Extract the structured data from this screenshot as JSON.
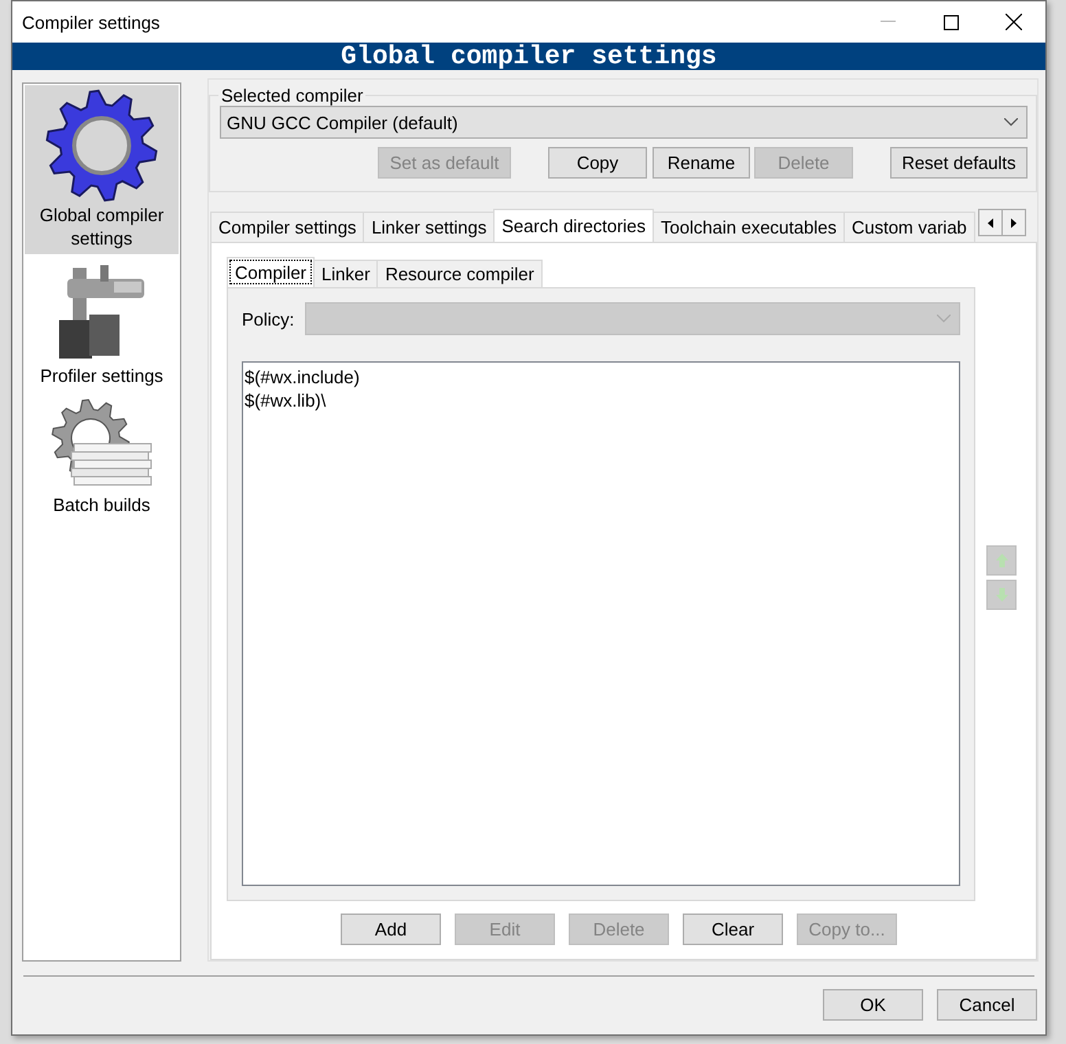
{
  "window": {
    "title": "Compiler settings"
  },
  "banner": "Global compiler settings",
  "sidebar": {
    "items": [
      {
        "label": "Global compiler settings",
        "kind": "gear",
        "selected": true
      },
      {
        "label": "Profiler settings",
        "kind": "caliper",
        "selected": false
      },
      {
        "label": "Batch builds",
        "kind": "batch",
        "selected": false
      }
    ]
  },
  "compiler_group": {
    "label": "Selected compiler",
    "value": "GNU GCC Compiler (default)",
    "buttons": [
      {
        "label": "Set as default",
        "disabled": true
      },
      {
        "label": "Copy",
        "disabled": false
      },
      {
        "label": "Rename",
        "disabled": false
      },
      {
        "label": "Delete",
        "disabled": true
      },
      {
        "label": "Reset defaults",
        "disabled": false
      }
    ]
  },
  "tabs": [
    {
      "label": "Compiler settings",
      "selected": false
    },
    {
      "label": "Linker settings",
      "selected": false
    },
    {
      "label": "Search directories",
      "selected": true
    },
    {
      "label": "Toolchain executables",
      "selected": false
    },
    {
      "label": "Custom variab",
      "selected": false
    }
  ],
  "inner_tabs": [
    {
      "label": "Compiler",
      "selected": true
    },
    {
      "label": "Linker",
      "selected": false
    },
    {
      "label": "Resource compiler",
      "selected": false
    }
  ],
  "policy": {
    "label": "Policy:",
    "disabled": true
  },
  "directories": [
    "$(#wx.include)",
    "$(#wx.lib)\\"
  ],
  "order_buttons": [
    {
      "kind": "up",
      "disabled": true
    },
    {
      "kind": "down",
      "disabled": true
    }
  ],
  "list_buttons": [
    {
      "label": "Add",
      "disabled": false
    },
    {
      "label": "Edit",
      "disabled": true
    },
    {
      "label": "Delete",
      "disabled": true
    },
    {
      "label": "Clear",
      "disabled": false
    },
    {
      "label": "Copy to...",
      "disabled": true
    }
  ],
  "dialog_buttons": [
    {
      "label": "OK",
      "disabled": false
    },
    {
      "label": "Cancel",
      "disabled": false
    }
  ]
}
